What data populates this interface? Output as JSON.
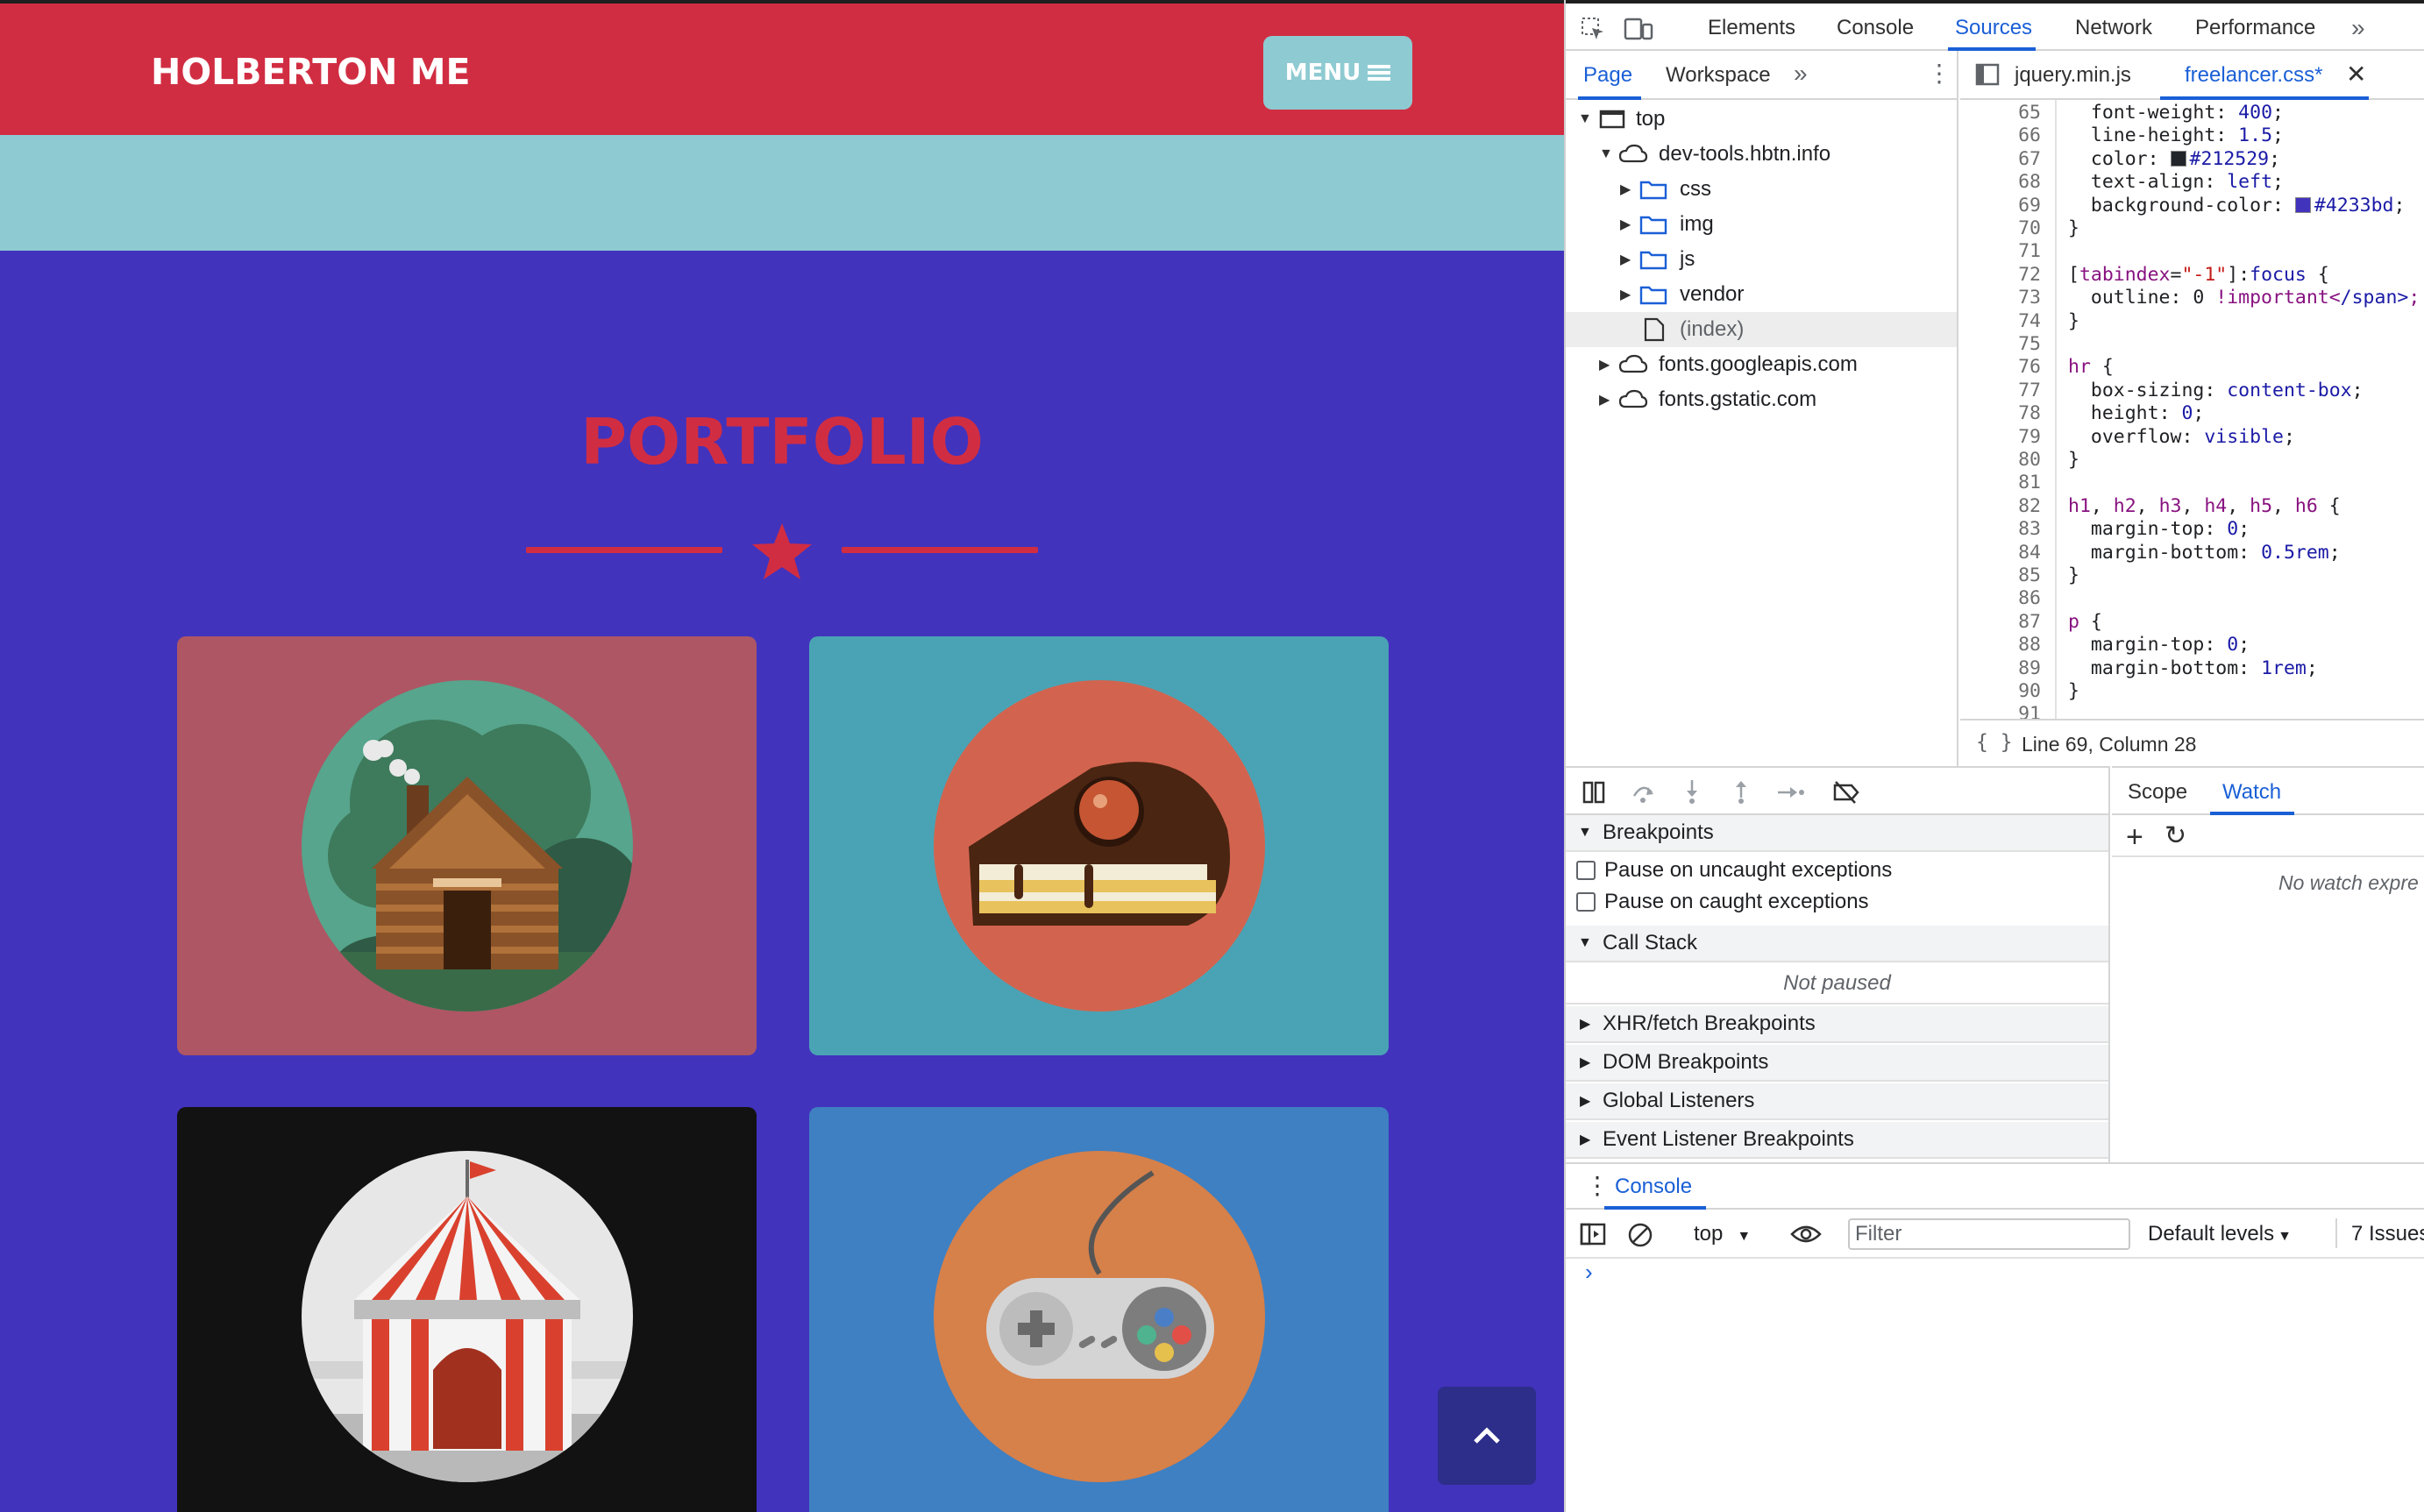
{
  "site": {
    "brand": "HOLBERTON ME",
    "menu_label": "MENU",
    "section_title": "PORTFOLIO",
    "colors": {
      "red": "#d12d42",
      "teal": "#8ecad1",
      "purple": "#4233bd"
    },
    "cards": [
      {
        "name": "cabin",
        "bg": "#ae5664"
      },
      {
        "name": "cake",
        "bg": "#4aa3b5"
      },
      {
        "name": "circus",
        "bg": "#121212"
      },
      {
        "name": "game",
        "bg": "#3e80c2"
      }
    ]
  },
  "devtools": {
    "main_tabs": [
      "Elements",
      "Console",
      "Sources",
      "Network",
      "Performance"
    ],
    "active_tab": "Sources",
    "nav_tabs": [
      "Page",
      "Workspace"
    ],
    "file_tree": [
      {
        "label": "top",
        "icon": "frame-icon",
        "expanded": true
      },
      {
        "label": "dev-tools.hbtn.info",
        "icon": "cloud-icon",
        "expanded": true
      },
      {
        "label": "css",
        "icon": "folder-icon"
      },
      {
        "label": "img",
        "icon": "folder-icon"
      },
      {
        "label": "js",
        "icon": "folder-icon"
      },
      {
        "label": "vendor",
        "icon": "folder-icon"
      },
      {
        "label": "(index)",
        "icon": "file-icon",
        "selected": true
      },
      {
        "label": "fonts.googleapis.com",
        "icon": "cloud-icon"
      },
      {
        "label": "fonts.gstatic.com",
        "icon": "cloud-icon"
      }
    ],
    "editor_tabs": [
      "jquery.min.js",
      "freelancer.css*"
    ],
    "code_lines": [
      {
        "n": "65",
        "text": "  font-weight: 400;"
      },
      {
        "n": "66",
        "text": "  line-height: 1.5;"
      },
      {
        "n": "67",
        "text": "  color: #212529;"
      },
      {
        "n": "68",
        "text": "  text-align: left;"
      },
      {
        "n": "69",
        "text": "  background-color: #4233bd;"
      },
      {
        "n": "70",
        "text": "}"
      },
      {
        "n": "71",
        "text": ""
      },
      {
        "n": "72",
        "text": "[tabindex=\"-1\"]:focus {"
      },
      {
        "n": "73",
        "text": "  outline: 0 !important;"
      },
      {
        "n": "74",
        "text": "}"
      },
      {
        "n": "75",
        "text": ""
      },
      {
        "n": "76",
        "text": "hr {"
      },
      {
        "n": "77",
        "text": "  box-sizing: content-box;"
      },
      {
        "n": "78",
        "text": "  height: 0;"
      },
      {
        "n": "79",
        "text": "  overflow: visible;"
      },
      {
        "n": "80",
        "text": "}"
      },
      {
        "n": "81",
        "text": ""
      },
      {
        "n": "82",
        "text": "h1, h2, h3, h4, h5, h6 {"
      },
      {
        "n": "83",
        "text": "  margin-top: 0;"
      },
      {
        "n": "84",
        "text": "  margin-bottom: 0.5rem;"
      },
      {
        "n": "85",
        "text": "}"
      },
      {
        "n": "86",
        "text": ""
      },
      {
        "n": "87",
        "text": "p {"
      },
      {
        "n": "88",
        "text": "  margin-top: 0;"
      },
      {
        "n": "89",
        "text": "  margin-bottom: 1rem;"
      },
      {
        "n": "90",
        "text": "}"
      },
      {
        "n": "91",
        "text": ""
      }
    ],
    "cursor_status": "Line 69, Column 28",
    "sidebar_tabs": [
      "Scope",
      "Watch"
    ],
    "breakpoints_label": "Breakpoints",
    "pause_uncaught": "Pause on uncaught exceptions",
    "pause_caught": "Pause on caught exceptions",
    "call_stack_label": "Call Stack",
    "not_paused": "Not paused",
    "sections": [
      "XHR/fetch Breakpoints",
      "DOM Breakpoints",
      "Global Listeners",
      "Event Listener Breakpoints"
    ],
    "watch_empty": "No watch expre",
    "drawer_tab": "Console",
    "context": "top",
    "filter_placeholder": "Filter",
    "levels": "Default levels",
    "issues": "7 Issues:"
  }
}
